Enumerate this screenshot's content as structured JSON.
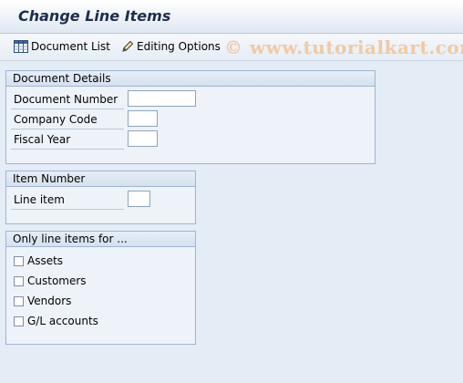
{
  "title": "Change Line Items",
  "toolbar": {
    "document_list_label": "Document List",
    "document_list_icon": "document-list-icon",
    "editing_options_label": "Editing Options",
    "editing_options_icon": "pencil-icon"
  },
  "watermark": "© www.tutorialkart.com",
  "document_details": {
    "heading": "Document Details",
    "document_number_label": "Document Number",
    "document_number_value": "",
    "company_code_label": "Company Code",
    "company_code_value": "",
    "fiscal_year_label": "Fiscal Year",
    "fiscal_year_value": ""
  },
  "item_number": {
    "heading": "Item Number",
    "line_item_label": "Line item",
    "line_item_value": ""
  },
  "only_line_items": {
    "heading": "Only line items for ...",
    "options": [
      {
        "label": "Assets",
        "checked": false
      },
      {
        "label": "Customers",
        "checked": false
      },
      {
        "label": "Vendors",
        "checked": false
      },
      {
        "label": "G/L accounts",
        "checked": false
      }
    ]
  }
}
